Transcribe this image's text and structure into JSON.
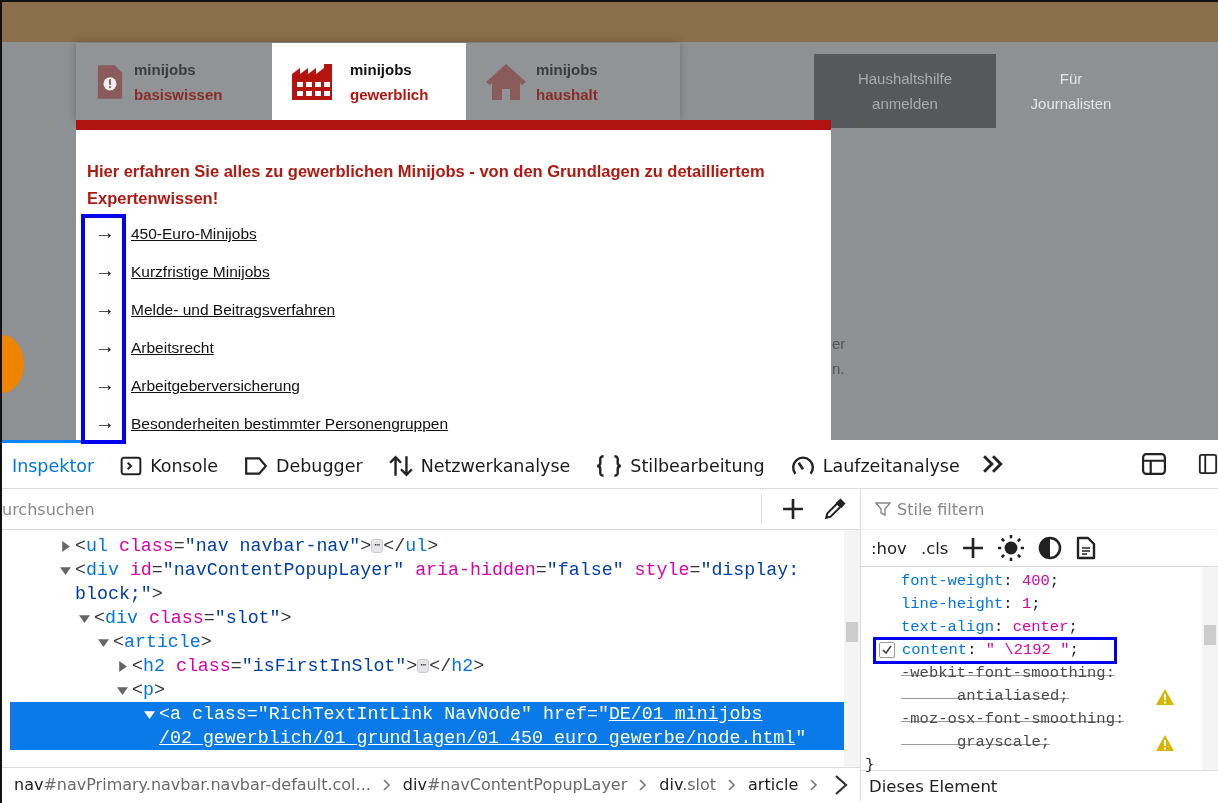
{
  "site": {
    "tabs": [
      {
        "line1": "minijobs",
        "line2": "basiswissen",
        "selected": false
      },
      {
        "line1": "minijobs",
        "line2": "gewerblich",
        "selected": true
      },
      {
        "line1": "minijobs",
        "line2": "haushalt",
        "selected": false
      }
    ],
    "nav": [
      {
        "label": "Haushaltshilfe anmelden",
        "selected": true
      },
      {
        "label": "Für Journalisten",
        "selected": false
      }
    ],
    "heading": "Hier erfahren Sie alles zu gewerblichen Minijobs - von den Grundlagen zu detailliertem Expertenwissen!",
    "links": [
      {
        "arrow": "→",
        "label": "450-Euro-Minijobs"
      },
      {
        "arrow": "→",
        "label": "Kurzfristige Minijobs"
      },
      {
        "arrow": "→",
        "label": "Melde- und Beitragsverfahren"
      },
      {
        "arrow": "→",
        "label": "Arbeitsrecht"
      },
      {
        "arrow": "→",
        "label": "Arbeitgeberversicherung"
      },
      {
        "arrow": "→",
        "label": "Besonderheiten bestimmter Personengruppen"
      }
    ],
    "background_fragments": [
      "er",
      "n."
    ]
  },
  "devtools": {
    "tabs": [
      {
        "label": "Inspektor",
        "selected": true
      },
      {
        "label": "Konsole",
        "selected": false
      },
      {
        "label": "Debugger",
        "selected": false
      },
      {
        "label": "Netzwerkanalyse",
        "selected": false
      },
      {
        "label": "Stilbearbeitung",
        "selected": false
      },
      {
        "label": "Laufzeitanalyse",
        "selected": false
      }
    ],
    "search": {
      "placeholder": "urchsuchen"
    },
    "tree": [
      {
        "expanded": false,
        "selected": false,
        "tokens": [
          {
            "kind": "punct",
            "t": "<"
          },
          {
            "kind": "tag",
            "t": "ul"
          },
          {
            "kind": "attr",
            "t": " class"
          },
          {
            "kind": "punct",
            "t": "="
          },
          {
            "kind": "value",
            "t": "\"nav navbar-nav\""
          },
          {
            "kind": "punct",
            "t": ">"
          },
          {
            "kind": "badge",
            "t": "⋯"
          },
          {
            "kind": "punct",
            "t": "</"
          },
          {
            "kind": "tag",
            "t": "ul"
          },
          {
            "kind": "punct",
            "t": ">"
          }
        ]
      },
      {
        "expanded": true,
        "selected": false,
        "tokens": [
          {
            "kind": "punct",
            "t": "<"
          },
          {
            "kind": "tag",
            "t": "div"
          },
          {
            "kind": "attr",
            "t": " id"
          },
          {
            "kind": "punct",
            "t": "="
          },
          {
            "kind": "value",
            "t": "\"navContentPopupLayer\""
          },
          {
            "kind": "attr",
            "t": " aria-hidden"
          },
          {
            "kind": "punct",
            "t": "="
          },
          {
            "kind": "value",
            "t": "\"false\""
          },
          {
            "kind": "attr",
            "t": " style"
          },
          {
            "kind": "punct",
            "t": "="
          },
          {
            "kind": "value",
            "t": "\"display: block;\""
          },
          {
            "kind": "punct",
            "t": ">"
          }
        ],
        "children": [
          {
            "expanded": true,
            "selected": false,
            "tokens": [
              {
                "kind": "punct",
                "t": "<"
              },
              {
                "kind": "tag",
                "t": "div"
              },
              {
                "kind": "attr",
                "t": " class"
              },
              {
                "kind": "punct",
                "t": "="
              },
              {
                "kind": "value",
                "t": "\"slot\""
              },
              {
                "kind": "punct",
                "t": ">"
              }
            ],
            "children": [
              {
                "expanded": true,
                "selected": false,
                "tokens": [
                  {
                    "kind": "punct",
                    "t": "<"
                  },
                  {
                    "kind": "tag",
                    "t": "article"
                  },
                  {
                    "kind": "punct",
                    "t": ">"
                  }
                ],
                "children": [
                  {
                    "expanded": false,
                    "selected": false,
                    "tokens": [
                      {
                        "kind": "punct",
                        "t": "<"
                      },
                      {
                        "kind": "tag",
                        "t": "h2"
                      },
                      {
                        "kind": "attr",
                        "t": " class"
                      },
                      {
                        "kind": "punct",
                        "t": "="
                      },
                      {
                        "kind": "value",
                        "t": "\"isFirstInSlot\""
                      },
                      {
                        "kind": "punct",
                        "t": ">"
                      },
                      {
                        "kind": "badge",
                        "t": "⋯"
                      },
                      {
                        "kind": "punct",
                        "t": "</"
                      },
                      {
                        "kind": "tag",
                        "t": "h2"
                      },
                      {
                        "kind": "punct",
                        "t": ">"
                      }
                    ]
                  },
                  {
                    "expanded": true,
                    "selected": false,
                    "tokens": [
                      {
                        "kind": "punct",
                        "t": "<"
                      },
                      {
                        "kind": "tag",
                        "t": "p"
                      },
                      {
                        "kind": "punct",
                        "t": ">"
                      }
                    ],
                    "children": [
                      {
                        "expanded": true,
                        "selected": true,
                        "tokens": [
                          {
                            "kind": "punct",
                            "t": "<"
                          },
                          {
                            "kind": "tag",
                            "t": "a"
                          },
                          {
                            "kind": "attr",
                            "t": " class"
                          },
                          {
                            "kind": "punct",
                            "t": "="
                          },
                          {
                            "kind": "value",
                            "t": "\"RichTextIntLink NavNode\""
                          },
                          {
                            "kind": "attr",
                            "t": " href"
                          },
                          {
                            "kind": "punct",
                            "t": "="
                          },
                          {
                            "kind": "value",
                            "t": "\""
                          },
                          {
                            "kind": "link",
                            "t": "DE/01_minijobs"
                          },
                          {
                            "kind": "link",
                            "t": "/02_gewerblich/01_grundlagen/01_450_euro_gewerbe/node.html"
                          },
                          {
                            "kind": "value",
                            "t": "\""
                          }
                        ]
                      }
                    ]
                  }
                ]
              }
            ]
          }
        ]
      }
    ],
    "breadcrumbs": [
      {
        "tag": "nav",
        "rest": "#navPrimary.navbar.navbar-default.col..."
      },
      {
        "tag": "div",
        "rest": "#navContentPopupLayer"
      },
      {
        "tag": "div",
        "rest": ".slot"
      },
      {
        "tag": "article"
      }
    ],
    "styles": {
      "filter_placeholder": "Stile filtern",
      "toolbar": [
        ":hov",
        ".cls"
      ],
      "declarations": [
        {
          "kind": "normal",
          "property": "font-weight",
          "sep": ": ",
          "value": "400",
          "end": ";"
        },
        {
          "kind": "normal",
          "property": "line-height",
          "sep": ": ",
          "value": "1",
          "end": ";"
        },
        {
          "kind": "normal",
          "property": "text-align",
          "sep": ": ",
          "value": "center",
          "end": ";"
        },
        {
          "kind": "hovered",
          "checked": true,
          "property": "content",
          "sep": ": ",
          "value": "\" \\2192 \"",
          "end": ";"
        },
        {
          "kind": "overridden",
          "property": "-webkit-font-smoothing",
          "sep": ":",
          "value": "antialiased",
          "end": ";"
        },
        {
          "kind": "overridden",
          "property": "-moz-osx-font-smoothing",
          "sep": ":",
          "value": "grayscale",
          "end": ";"
        }
      ],
      "close": "}",
      "section": "Dieses Element"
    }
  }
}
